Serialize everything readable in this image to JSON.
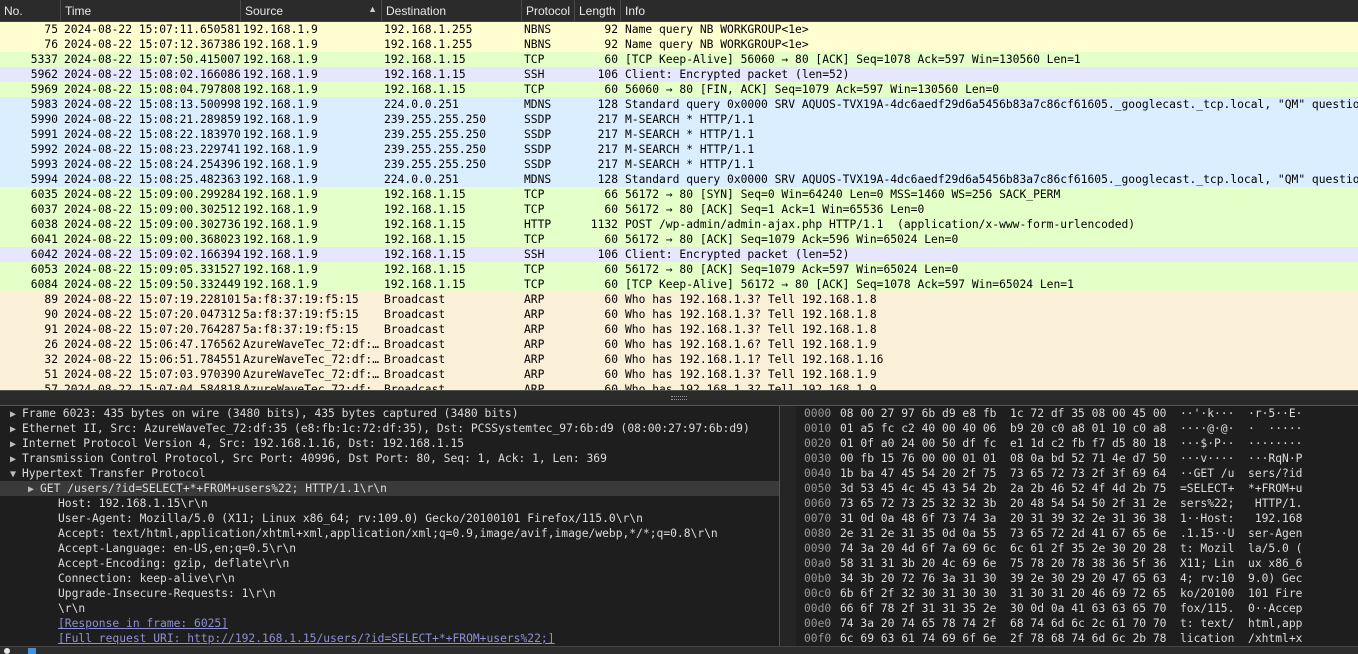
{
  "packet_list": {
    "columns": [
      "No.",
      "Time",
      "Source",
      "Destination",
      "Protocol",
      "Length",
      "Info"
    ],
    "rows": [
      {
        "no": "75",
        "time": "2024-08-22 15:07:11.650581",
        "src": "192.168.1.9",
        "dst": "192.168.1.255",
        "proto": "NBNS",
        "len": "92",
        "info": "Name query NB WORKGROUP<1e>",
        "cls": "nbns"
      },
      {
        "no": "76",
        "time": "2024-08-22 15:07:12.367386",
        "src": "192.168.1.9",
        "dst": "192.168.1.255",
        "proto": "NBNS",
        "len": "92",
        "info": "Name query NB WORKGROUP<1e>",
        "cls": "nbns"
      },
      {
        "no": "5337",
        "time": "2024-08-22 15:07:50.415007",
        "src": "192.168.1.9",
        "dst": "192.168.1.15",
        "proto": "TCP",
        "len": "60",
        "info": "[TCP Keep-Alive] 56060 → 80 [ACK] Seq=1078 Ack=597 Win=130560 Len=1",
        "cls": "tcp"
      },
      {
        "no": "5962",
        "time": "2024-08-22 15:08:02.166086",
        "src": "192.168.1.9",
        "dst": "192.168.1.15",
        "proto": "SSH",
        "len": "106",
        "info": "Client: Encrypted packet (len=52)",
        "cls": "ssh"
      },
      {
        "no": "5969",
        "time": "2024-08-22 15:08:04.797808",
        "src": "192.168.1.9",
        "dst": "192.168.1.15",
        "proto": "TCP",
        "len": "60",
        "info": "56060 → 80 [FIN, ACK] Seq=1079 Ack=597 Win=130560 Len=0",
        "cls": "tcp"
      },
      {
        "no": "5983",
        "time": "2024-08-22 15:08:13.500998",
        "src": "192.168.1.9",
        "dst": "224.0.0.251",
        "proto": "MDNS",
        "len": "128",
        "info": "Standard query 0x0000 SRV AQUOS-TVX19A-4dc6aedf29d6a5456b83a7c86cf61605._googlecast._tcp.local, \"QM\" question",
        "cls": "mdns"
      },
      {
        "no": "5990",
        "time": "2024-08-22 15:08:21.289859",
        "src": "192.168.1.9",
        "dst": "239.255.255.250",
        "proto": "SSDP",
        "len": "217",
        "info": "M-SEARCH * HTTP/1.1",
        "cls": "ssdp"
      },
      {
        "no": "5991",
        "time": "2024-08-22 15:08:22.183970",
        "src": "192.168.1.9",
        "dst": "239.255.255.250",
        "proto": "SSDP",
        "len": "217",
        "info": "M-SEARCH * HTTP/1.1",
        "cls": "ssdp"
      },
      {
        "no": "5992",
        "time": "2024-08-22 15:08:23.229741",
        "src": "192.168.1.9",
        "dst": "239.255.255.250",
        "proto": "SSDP",
        "len": "217",
        "info": "M-SEARCH * HTTP/1.1",
        "cls": "ssdp"
      },
      {
        "no": "5993",
        "time": "2024-08-22 15:08:24.254396",
        "src": "192.168.1.9",
        "dst": "239.255.255.250",
        "proto": "SSDP",
        "len": "217",
        "info": "M-SEARCH * HTTP/1.1",
        "cls": "ssdp"
      },
      {
        "no": "5994",
        "time": "2024-08-22 15:08:25.482363",
        "src": "192.168.1.9",
        "dst": "224.0.0.251",
        "proto": "MDNS",
        "len": "128",
        "info": "Standard query 0x0000 SRV AQUOS-TVX19A-4dc6aedf29d6a5456b83a7c86cf61605._googlecast._tcp.local, \"QM\" question",
        "cls": "mdns"
      },
      {
        "no": "6035",
        "time": "2024-08-22 15:09:00.299284",
        "src": "192.168.1.9",
        "dst": "192.168.1.15",
        "proto": "TCP",
        "len": "66",
        "info": "56172 → 80 [SYN] Seq=0 Win=64240 Len=0 MSS=1460 WS=256 SACK_PERM",
        "cls": "tcp"
      },
      {
        "no": "6037",
        "time": "2024-08-22 15:09:00.302512",
        "src": "192.168.1.9",
        "dst": "192.168.1.15",
        "proto": "TCP",
        "len": "60",
        "info": "56172 → 80 [ACK] Seq=1 Ack=1 Win=65536 Len=0",
        "cls": "tcp"
      },
      {
        "no": "6038",
        "time": "2024-08-22 15:09:00.302736",
        "src": "192.168.1.9",
        "dst": "192.168.1.15",
        "proto": "HTTP",
        "len": "1132",
        "info": "POST /wp-admin/admin-ajax.php HTTP/1.1  (application/x-www-form-urlencoded)",
        "cls": "http"
      },
      {
        "no": "6041",
        "time": "2024-08-22 15:09:00.368023",
        "src": "192.168.1.9",
        "dst": "192.168.1.15",
        "proto": "TCP",
        "len": "60",
        "info": "56172 → 80 [ACK] Seq=1079 Ack=596 Win=65024 Len=0",
        "cls": "tcp"
      },
      {
        "no": "6042",
        "time": "2024-08-22 15:09:02.166394",
        "src": "192.168.1.9",
        "dst": "192.168.1.15",
        "proto": "SSH",
        "len": "106",
        "info": "Client: Encrypted packet (len=52)",
        "cls": "ssh"
      },
      {
        "no": "6053",
        "time": "2024-08-22 15:09:05.331527",
        "src": "192.168.1.9",
        "dst": "192.168.1.15",
        "proto": "TCP",
        "len": "60",
        "info": "56172 → 80 [ACK] Seq=1079 Ack=597 Win=65024 Len=0",
        "cls": "tcp"
      },
      {
        "no": "6084",
        "time": "2024-08-22 15:09:50.332449",
        "src": "192.168.1.9",
        "dst": "192.168.1.15",
        "proto": "TCP",
        "len": "60",
        "info": "[TCP Keep-Alive] 56172 → 80 [ACK] Seq=1078 Ack=597 Win=65024 Len=1",
        "cls": "tcp"
      },
      {
        "no": "89",
        "time": "2024-08-22 15:07:19.228101",
        "src": "5a:f8:37:19:f5:15",
        "dst": "Broadcast",
        "proto": "ARP",
        "len": "60",
        "info": "Who has 192.168.1.3? Tell 192.168.1.8",
        "cls": "arp"
      },
      {
        "no": "90",
        "time": "2024-08-22 15:07:20.047312",
        "src": "5a:f8:37:19:f5:15",
        "dst": "Broadcast",
        "proto": "ARP",
        "len": "60",
        "info": "Who has 192.168.1.3? Tell 192.168.1.8",
        "cls": "arp"
      },
      {
        "no": "91",
        "time": "2024-08-22 15:07:20.764287",
        "src": "5a:f8:37:19:f5:15",
        "dst": "Broadcast",
        "proto": "ARP",
        "len": "60",
        "info": "Who has 192.168.1.3? Tell 192.168.1.8",
        "cls": "arp"
      },
      {
        "no": "26",
        "time": "2024-08-22 15:06:47.176562",
        "src": "AzureWaveTec_72:df:…",
        "dst": "Broadcast",
        "proto": "ARP",
        "len": "60",
        "info": "Who has 192.168.1.6? Tell 192.168.1.9",
        "cls": "arp"
      },
      {
        "no": "32",
        "time": "2024-08-22 15:06:51.784551",
        "src": "AzureWaveTec_72:df:…",
        "dst": "Broadcast",
        "proto": "ARP",
        "len": "60",
        "info": "Who has 192.168.1.1? Tell 192.168.1.16",
        "cls": "arp"
      },
      {
        "no": "51",
        "time": "2024-08-22 15:07:03.970390",
        "src": "AzureWaveTec_72:df:…",
        "dst": "Broadcast",
        "proto": "ARP",
        "len": "60",
        "info": "Who has 192.168.1.3? Tell 192.168.1.9",
        "cls": "arp"
      },
      {
        "no": "57",
        "time": "2024-08-22 15:07:04.584818",
        "src": "AzureWaveTec_72:df:…",
        "dst": "Broadcast",
        "proto": "ARP",
        "len": "60",
        "info": "Who has 192.168.1.3? Tell 192.168.1.9",
        "cls": "arp"
      }
    ]
  },
  "details": {
    "rows": [
      {
        "level": 1,
        "twisty": "▶",
        "text": "Frame 6023: 435 bytes on wire (3480 bits), 435 bytes captured (3480 bits)",
        "kind": "normal"
      },
      {
        "level": 1,
        "twisty": "▶",
        "text": "Ethernet II, Src: AzureWaveTec_72:df:35 (e8:fb:1c:72:df:35), Dst: PCSSystemtec_97:6b:d9 (08:00:27:97:6b:d9)",
        "kind": "normal"
      },
      {
        "level": 1,
        "twisty": "▶",
        "text": "Internet Protocol Version 4, Src: 192.168.1.16, Dst: 192.168.1.15",
        "kind": "normal"
      },
      {
        "level": 1,
        "twisty": "▶",
        "text": "Transmission Control Protocol, Src Port: 40996, Dst Port: 80, Seq: 1, Ack: 1, Len: 369",
        "kind": "normal"
      },
      {
        "level": 1,
        "twisty": "▼",
        "text": "Hypertext Transfer Protocol",
        "kind": "normal"
      },
      {
        "level": 2,
        "twisty": "▶",
        "text": "GET /users/?id=SELECT+*+FROM+users%22; HTTP/1.1\\r\\n",
        "kind": "sel"
      },
      {
        "level": 3,
        "twisty": "",
        "text": "Host: 192.168.1.15\\r\\n",
        "kind": "normal"
      },
      {
        "level": 3,
        "twisty": "",
        "text": "User-Agent: Mozilla/5.0 (X11; Linux x86_64; rv:109.0) Gecko/20100101 Firefox/115.0\\r\\n",
        "kind": "normal"
      },
      {
        "level": 3,
        "twisty": "",
        "text": "Accept: text/html,application/xhtml+xml,application/xml;q=0.9,image/avif,image/webp,*/*;q=0.8\\r\\n",
        "kind": "normal"
      },
      {
        "level": 3,
        "twisty": "",
        "text": "Accept-Language: en-US,en;q=0.5\\r\\n",
        "kind": "normal"
      },
      {
        "level": 3,
        "twisty": "",
        "text": "Accept-Encoding: gzip, deflate\\r\\n",
        "kind": "normal"
      },
      {
        "level": 3,
        "twisty": "",
        "text": "Connection: keep-alive\\r\\n",
        "kind": "normal"
      },
      {
        "level": 3,
        "twisty": "",
        "text": "Upgrade-Insecure-Requests: 1\\r\\n",
        "kind": "normal"
      },
      {
        "level": 3,
        "twisty": "",
        "text": "\\r\\n",
        "kind": "normal"
      },
      {
        "level": 3,
        "twisty": "",
        "text": "[Response in frame: 6025]",
        "kind": "link"
      },
      {
        "level": 3,
        "twisty": "",
        "text": "[Full request URI: http://192.168.1.15/users/?id=SELECT+*+FROM+users%22;]",
        "kind": "link"
      }
    ]
  },
  "bytes": {
    "rows": [
      {
        "off": "0000",
        "hex": "08 00 27 97 6b d9 e8 fb  1c 72 df 35 08 00 45 00",
        "ascii": "··'·k···  ·r·5··E·"
      },
      {
        "off": "0010",
        "hex": "01 a5 fc c2 40 00 40 06  b9 20 c0 a8 01 10 c0 a8",
        "ascii": "····@·@·  ·  ·····"
      },
      {
        "off": "0020",
        "hex": "01 0f a0 24 00 50 df fc  e1 1d c2 fb f7 d5 80 18",
        "ascii": "···$·P··  ········"
      },
      {
        "off": "0030",
        "hex": "00 fb 15 76 00 00 01 01  08 0a bd 52 71 4e d7 50",
        "ascii": "···v····  ···RqN·P"
      },
      {
        "off": "0040",
        "hex": "1b ba 47 45 54 20 2f 75  73 65 72 73 2f 3f 69 64",
        "ascii": "··GET /u  sers/?id"
      },
      {
        "off": "0050",
        "hex": "3d 53 45 4c 45 43 54 2b  2a 2b 46 52 4f 4d 2b 75",
        "ascii": "=SELECT+  *+FROM+u"
      },
      {
        "off": "0060",
        "hex": "73 65 72 73 25 32 32 3b  20 48 54 54 50 2f 31 2e",
        "ascii": "sers%22;   HTTP/1."
      },
      {
        "off": "0070",
        "hex": "31 0d 0a 48 6f 73 74 3a  20 31 39 32 2e 31 36 38",
        "ascii": "1··Host:   192.168"
      },
      {
        "off": "0080",
        "hex": "2e 31 2e 31 35 0d 0a 55  73 65 72 2d 41 67 65 6e",
        "ascii": ".1.15··U  ser-Agen"
      },
      {
        "off": "0090",
        "hex": "74 3a 20 4d 6f 7a 69 6c  6c 61 2f 35 2e 30 20 28",
        "ascii": "t: Mozil  la/5.0 ("
      },
      {
        "off": "00a0",
        "hex": "58 31 31 3b 20 4c 69 6e  75 78 20 78 38 36 5f 36",
        "ascii": "X11; Lin  ux x86_6"
      },
      {
        "off": "00b0",
        "hex": "34 3b 20 72 76 3a 31 30  39 2e 30 29 20 47 65 63",
        "ascii": "4; rv:10  9.0) Gec"
      },
      {
        "off": "00c0",
        "hex": "6b 6f 2f 32 30 31 30 30  31 30 31 20 46 69 72 65",
        "ascii": "ko/20100  101 Fire"
      },
      {
        "off": "00d0",
        "hex": "66 6f 78 2f 31 31 35 2e  30 0d 0a 41 63 63 65 70",
        "ascii": "fox/115.  0··Accep"
      },
      {
        "off": "00e0",
        "hex": "74 3a 20 74 65 78 74 2f  68 74 6d 6c 2c 61 70 70",
        "ascii": "t: text/  html,app"
      },
      {
        "off": "00f0",
        "hex": "6c 69 63 61 74 69 6f 6e  2f 78 68 74 6d 6c 2b 78",
        "ascii": "lication  /xhtml+x"
      }
    ]
  },
  "colors": {
    "nbns": "#fefed0",
    "tcp": "#e4ffc7",
    "ssh": "#e7e6ff",
    "mdns": "#daeeff",
    "ssdp": "#daeeff",
    "http": "#e4ffc7",
    "arp": "#faf0d7"
  }
}
